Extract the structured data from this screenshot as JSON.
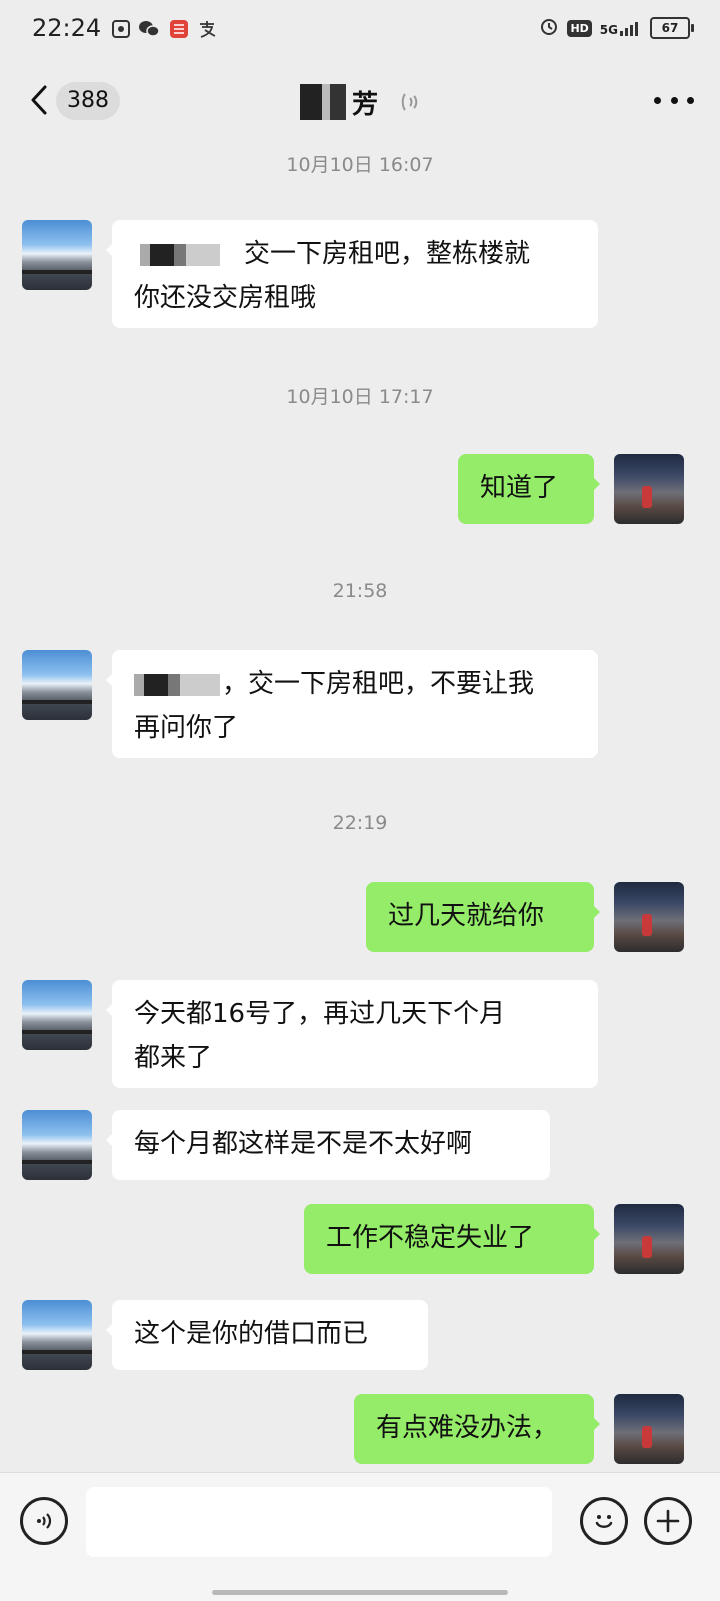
{
  "status_bar": {
    "time": "22:24",
    "left_icons": [
      "gallery-icon",
      "wechat-icon",
      "shield-app-icon",
      "alipay-icon"
    ],
    "hd": "HD",
    "network": "5G",
    "battery": "67"
  },
  "header": {
    "unread_count": "388",
    "title_visible": "芳",
    "title_redacted": true
  },
  "messages": [
    {
      "kind": "time",
      "text": "10月10日 16:07"
    },
    {
      "kind": "in",
      "line1": "交一下房租吧，整栋楼就",
      "line2": "你还没交房租哦"
    },
    {
      "kind": "time",
      "text": "10月10日 17:17"
    },
    {
      "kind": "out",
      "text": "知道了"
    },
    {
      "kind": "time",
      "text": "21:58"
    },
    {
      "kind": "in",
      "line1": "，交一下房租吧，不要让我",
      "line2": "再问你了"
    },
    {
      "kind": "time",
      "text": "22:19"
    },
    {
      "kind": "out",
      "text": "过几天就给你"
    },
    {
      "kind": "in",
      "line1": "今天都16号了，再过几天下个月",
      "line2": "都来了"
    },
    {
      "kind": "in",
      "text": "每个月都这样是不是不太好啊"
    },
    {
      "kind": "out",
      "text": "工作不稳定失业了"
    },
    {
      "kind": "in",
      "text": "这个是你的借口而已"
    },
    {
      "kind": "out",
      "text": "有点难没办法，"
    }
  ],
  "input_bar": {
    "placeholder": "",
    "icons": [
      "voice-input-icon",
      "emoji-icon",
      "plus-icon"
    ]
  },
  "colors": {
    "background": "#ededed",
    "incoming_bubble": "#ffffff",
    "outgoing_bubble": "#95ec69",
    "timestamp": "#8a8a8a"
  }
}
